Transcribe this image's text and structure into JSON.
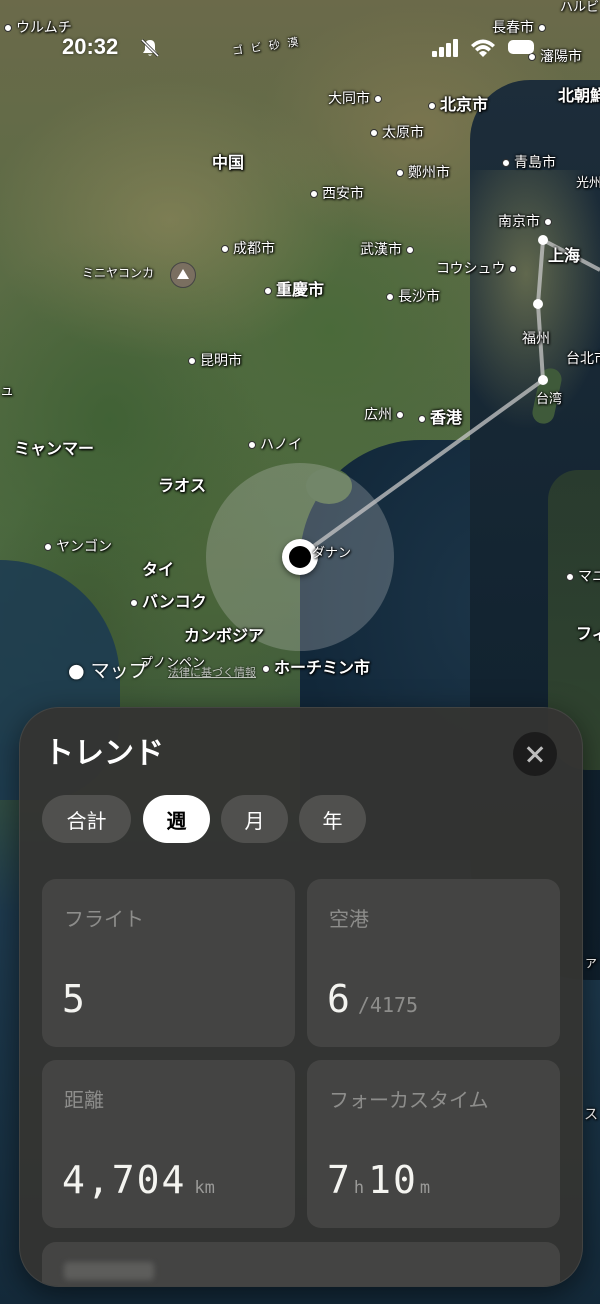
{
  "status_bar": {
    "time": "20:32"
  },
  "map": {
    "labels": {
      "urumqi": "ウルムチ",
      "gobi": "ゴ ビ 砂 漠",
      "changchun": "長春市",
      "shenyang": "瀋陽市",
      "datong": "大同市",
      "beijing": "北京市",
      "north_korea": "北朝鮮",
      "china": "中国",
      "taiyuan": "太原市",
      "zhengzhou": "鄭州市",
      "qingdao": "青島市",
      "gwangju": "光州",
      "xian": "西安市",
      "nanjing": "南京市",
      "chengdu": "成都市",
      "wuhan": "武漢市",
      "shanghai": "上海",
      "hangzhou": "コウシュウ",
      "minya_konka": "ミニヤコンカ",
      "chongqing": "重慶市",
      "changsha": "長沙市",
      "fuzhou": "福州",
      "taipei": "台北市",
      "kunming": "昆明市",
      "taiwan": "台湾",
      "guangzhou": "広州",
      "hong_kong": "香港",
      "myanmar": "ミャンマー",
      "hanoi": "ハノイ",
      "laos": "ラオス",
      "yangon": "ヤンゴン",
      "danang": "ダナン",
      "thailand": "タイ",
      "bangkok": "バンコク",
      "cambodia": "カンボジア",
      "phnom_penh": "プノンペン",
      "ho_chi_minh": "ホーチミン市",
      "edge_west": "ュ",
      "edge_manila": "マニ",
      "edge_philippines": "フィ",
      "edge_a": "ァ",
      "edge_s": "ス",
      "edge_harbin": "ハルビ"
    },
    "brand": "マップ",
    "legal": "法律に基づく情報"
  },
  "trends": {
    "title": "トレンド",
    "segments": [
      "合計",
      "週",
      "月",
      "年"
    ],
    "selected_segment": "週",
    "cards": {
      "flights": {
        "label": "フライト",
        "value": "5"
      },
      "airports": {
        "label": "空港",
        "value": "6",
        "total": "/4175"
      },
      "distance": {
        "label": "距離",
        "value": "4,704",
        "unit": "km"
      },
      "focus_time": {
        "label": "フォーカスタイム",
        "hours": "7",
        "hours_unit": "h",
        "minutes": "10",
        "minutes_unit": "m"
      }
    }
  },
  "colors": {
    "sheet_bg": "#343432",
    "card_bg": "#464644",
    "selected_segment_bg": "#ffffff",
    "flight_path": "#c8c8c8"
  },
  "icons": [
    "bell-slash-icon",
    "cellular-signal-icon",
    "wifi-icon",
    "battery-icon",
    "mountain-icon",
    "apple-logo-icon",
    "close-icon"
  ]
}
